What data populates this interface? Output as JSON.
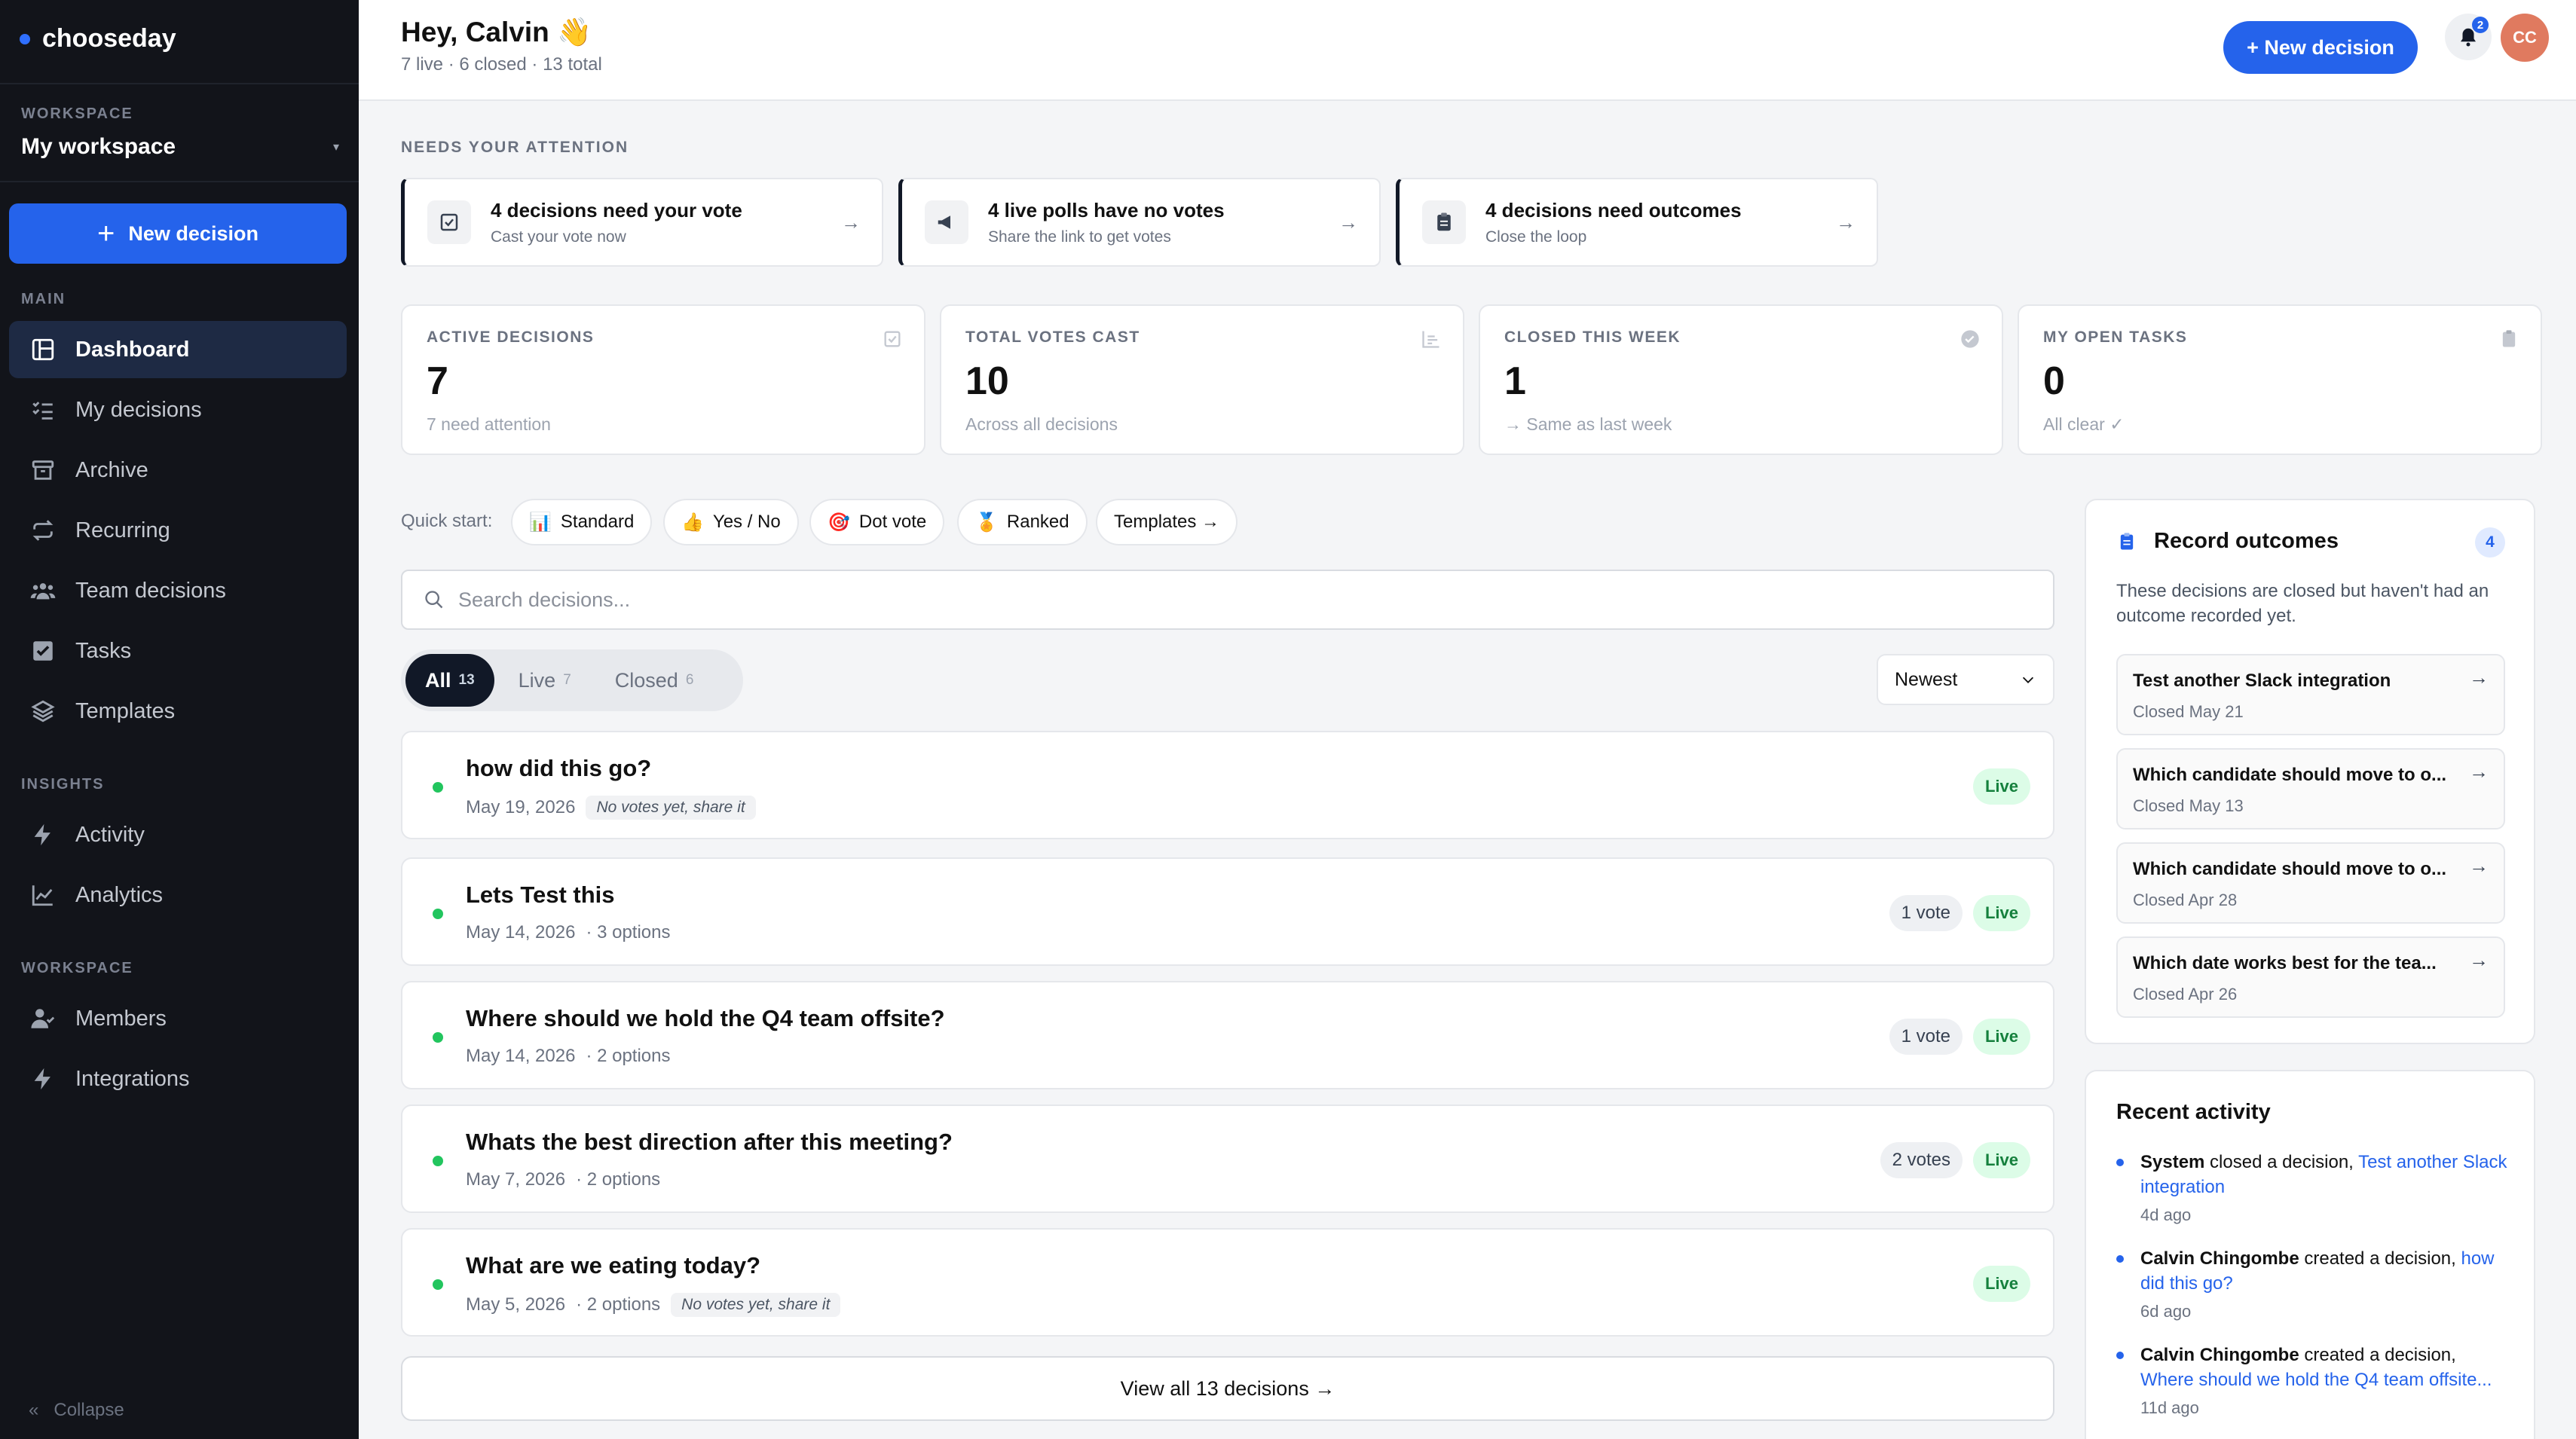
{
  "brand": {
    "name": "chooseday",
    "accent": "#2563eb"
  },
  "sidebar": {
    "workspace_label": "WORKSPACE",
    "workspace_name": "My workspace",
    "new_decision": "New decision",
    "main_label": "MAIN",
    "main_items": [
      {
        "label": "Dashboard",
        "icon": "dashboard-icon",
        "active": true
      },
      {
        "label": "My decisions",
        "icon": "list-icon"
      },
      {
        "label": "Archive",
        "icon": "archive-icon"
      },
      {
        "label": "Recurring",
        "icon": "repeat-icon"
      },
      {
        "label": "Team decisions",
        "icon": "team-icon"
      },
      {
        "label": "Tasks",
        "icon": "checkbox-icon"
      },
      {
        "label": "Templates",
        "icon": "layers-icon"
      }
    ],
    "insights_label": "INSIGHTS",
    "insights_items": [
      {
        "label": "Activity",
        "icon": "bolt-icon"
      },
      {
        "label": "Analytics",
        "icon": "chart-icon"
      }
    ],
    "workspace2_label": "WORKSPACE",
    "workspace_items": [
      {
        "label": "Members",
        "icon": "member-icon"
      },
      {
        "label": "Integrations",
        "icon": "bolt-icon"
      }
    ],
    "collapse": "Collapse"
  },
  "header": {
    "greeting": "Hey, Calvin 👋",
    "summary": "7 live · 6 closed · 13 total",
    "new_decision": "+ New decision",
    "notifications": "2",
    "avatar": "CC"
  },
  "attention": {
    "label": "NEEDS YOUR ATTENTION",
    "cards": [
      {
        "title": "4 decisions need your vote",
        "sub": "Cast your vote now",
        "icon": "ballot-icon"
      },
      {
        "title": "4 live polls have no votes",
        "sub": "Share the link to get votes",
        "icon": "megaphone-icon"
      },
      {
        "title": "4 decisions need outcomes",
        "sub": "Close the loop",
        "icon": "clipboard-icon"
      }
    ]
  },
  "stats": [
    {
      "label": "ACTIVE DECISIONS",
      "value": "7",
      "sub": "7 need attention",
      "icon": "ballot-icon"
    },
    {
      "label": "TOTAL VOTES CAST",
      "value": "10",
      "sub": "Across all decisions",
      "icon": "bar-chart-icon"
    },
    {
      "label": "CLOSED THIS WEEK",
      "value": "1",
      "sub": "→ Same as last week",
      "icon": "check-circle-icon"
    },
    {
      "label": "MY OPEN TASKS",
      "value": "0",
      "sub": "All clear ✓",
      "icon": "clipboard-icon"
    }
  ],
  "quick_start": {
    "label": "Quick start:",
    "chips": [
      {
        "emoji": "📊",
        "label": "Standard"
      },
      {
        "emoji": "👍",
        "label": "Yes / No"
      },
      {
        "emoji": "🎯",
        "label": "Dot vote"
      },
      {
        "emoji": "🏅",
        "label": "Ranked"
      },
      {
        "emoji": "",
        "label": "Templates →"
      }
    ]
  },
  "search": {
    "placeholder": "Search decisions..."
  },
  "filters": {
    "tabs": [
      {
        "label": "All",
        "count": "13",
        "active": true
      },
      {
        "label": "Live",
        "count": "7"
      },
      {
        "label": "Closed",
        "count": "6"
      }
    ],
    "sort": "Newest"
  },
  "decisions": [
    {
      "title": "how did this go?",
      "date": "May 19, 2026",
      "options": "",
      "hint": "No votes yet, share it",
      "votes": "",
      "status": "Live"
    },
    {
      "title": "Lets Test this",
      "date": "May 14, 2026",
      "options": "· 3 options",
      "hint": "",
      "votes": "1 vote",
      "status": "Live"
    },
    {
      "title": "Where should we hold the Q4 team offsite?",
      "date": "May 14, 2026",
      "options": "· 2 options",
      "hint": "",
      "votes": "1 vote",
      "status": "Live"
    },
    {
      "title": "Whats the best direction after this meeting?",
      "date": "May 7, 2026",
      "options": "· 2 options",
      "hint": "",
      "votes": "2 votes",
      "status": "Live"
    },
    {
      "title": "What are we eating today?",
      "date": "May 5, 2026",
      "options": "· 2 options",
      "hint": "No votes yet, share it",
      "votes": "",
      "status": "Live"
    }
  ],
  "view_all": "View all 13 decisions →",
  "outcomes": {
    "title": "Record outcomes",
    "count": "4",
    "desc": "These decisions are closed but haven't had an outcome recorded yet.",
    "items": [
      {
        "title": "Test another Slack integration",
        "closed": "Closed May 21"
      },
      {
        "title": "Which candidate should move to o...",
        "closed": "Closed May 13"
      },
      {
        "title": "Which candidate should move to o...",
        "closed": "Closed Apr 28"
      },
      {
        "title": "Which date works best for the tea...",
        "closed": "Closed Apr 26"
      }
    ]
  },
  "activity": {
    "title": "Recent activity",
    "items": [
      {
        "who": "System",
        "action": " closed a decision, ",
        "target": "Test another Slack integration",
        "ago": "4d ago"
      },
      {
        "who": "Calvin Chingombe",
        "action": " created a decision, ",
        "target": "how did this go?",
        "ago": "6d ago"
      },
      {
        "who": "Calvin Chingombe",
        "action": " created a decision, ",
        "target": "Where should we hold the Q4 team offsite...",
        "ago": "11d ago"
      }
    ]
  }
}
